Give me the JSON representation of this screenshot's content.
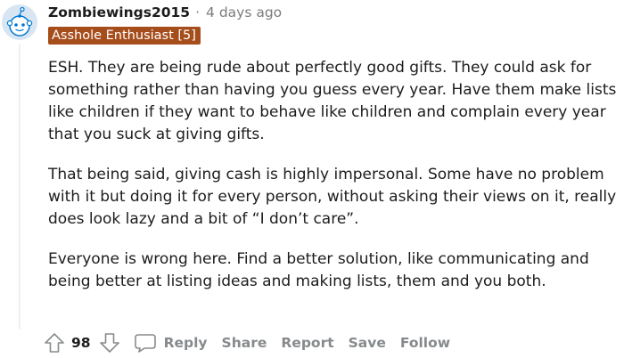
{
  "comment": {
    "username": "Zombiewings2015",
    "separator": "·",
    "time": "4 days ago",
    "flair": "Asshole Enthusiast [5]",
    "paragraphs": [
      "ESH. They are being rude about perfectly good gifts. They could ask for something rather than having you guess every year. Have them make lists like children if they want to behave like children and complain every year that you suck at giving gifts.",
      "That being said, giving cash is highly impersonal. Some have no problem with it but doing it for every person, without asking their views on it, really does look lazy and a bit of “I don’t care”.",
      "Everyone is wrong here. Find a better solution, like communicating and being better at listing ideas and making lists, them and you both."
    ]
  },
  "actions": {
    "score": "98",
    "reply": "Reply",
    "share": "Share",
    "report": "Report",
    "save": "Save",
    "follow": "Follow"
  },
  "icons": {
    "avatar": "snoo-avatar-icon",
    "upvote": "upvote-arrow-icon",
    "downvote": "downvote-arrow-icon",
    "reply": "speech-bubble-icon"
  },
  "colors": {
    "flair_bg": "#a64d1c",
    "avatar_accent": "#0079d3",
    "muted": "#878a8c"
  }
}
